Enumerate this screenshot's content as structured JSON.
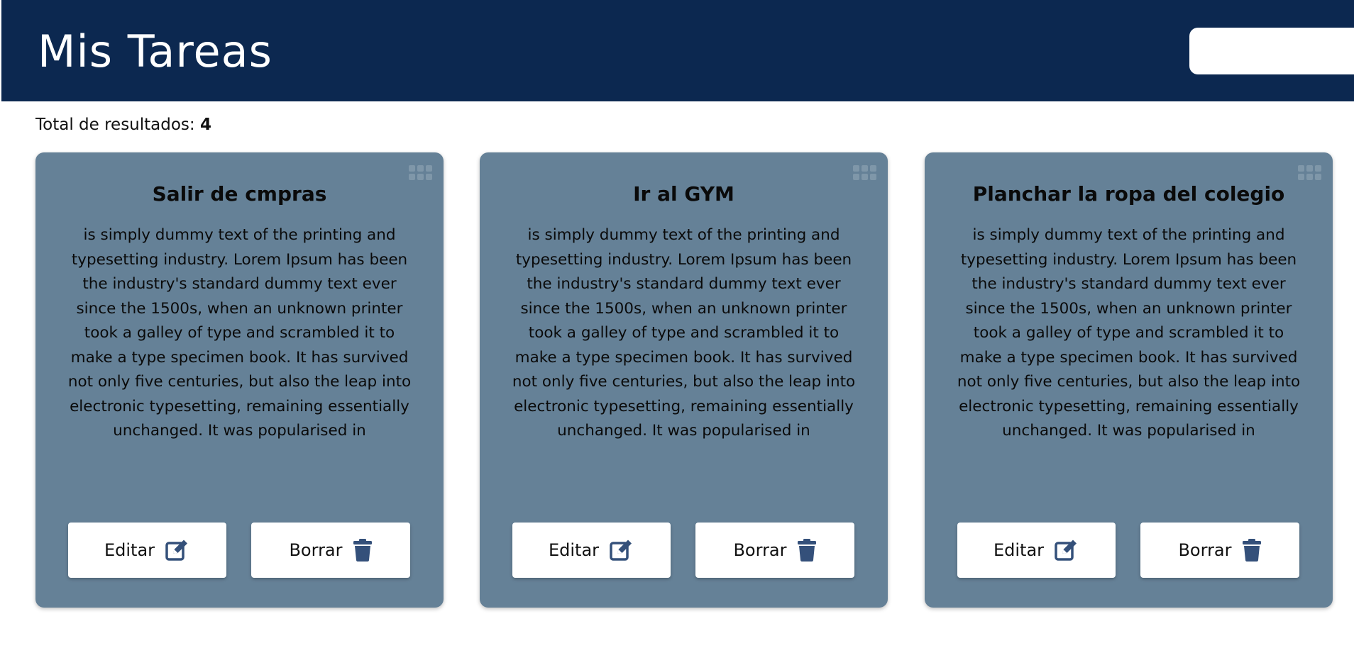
{
  "header": {
    "title": "Mis Tareas",
    "search_value": "",
    "background_color": "#0c2850"
  },
  "results": {
    "label": "Total de resultados:",
    "count": "4"
  },
  "card_color": "#658197",
  "icons": {
    "edit": "pen-to-square-icon",
    "delete": "trash-icon",
    "drag": "drag-grip-icon",
    "icon_color": "#34507a"
  },
  "tasks": [
    {
      "title": "Salir de cmpras",
      "description": "is simply dummy text of the printing and typesetting industry. Lorem Ipsum has been the industry's standard dummy text ever since the 1500s, when an unknown printer took a galley of type and scrambled it to make a type specimen book. It has survived not only five centuries, but also the leap into electronic typesetting, remaining essentially unchanged. It was popularised in",
      "edit_label": "Editar",
      "delete_label": "Borrar"
    },
    {
      "title": "Ir al GYM",
      "description": "is simply dummy text of the printing and typesetting industry. Lorem Ipsum has been the industry's standard dummy text ever since the 1500s, when an unknown printer took a galley of type and scrambled it to make a type specimen book. It has survived not only five centuries, but also the leap into electronic typesetting, remaining essentially unchanged. It was popularised in",
      "edit_label": "Editar",
      "delete_label": "Borrar"
    },
    {
      "title": "Planchar la ropa del colegio",
      "description": "is simply dummy text of the printing and typesetting industry. Lorem Ipsum has been the industry's standard dummy text ever since the 1500s, when an unknown printer took a galley of type and scrambled it to make a type specimen book. It has survived not only five centuries, but also the leap into electronic typesetting, remaining essentially unchanged. It was popularised in",
      "edit_label": "Editar",
      "delete_label": "Borrar"
    }
  ]
}
